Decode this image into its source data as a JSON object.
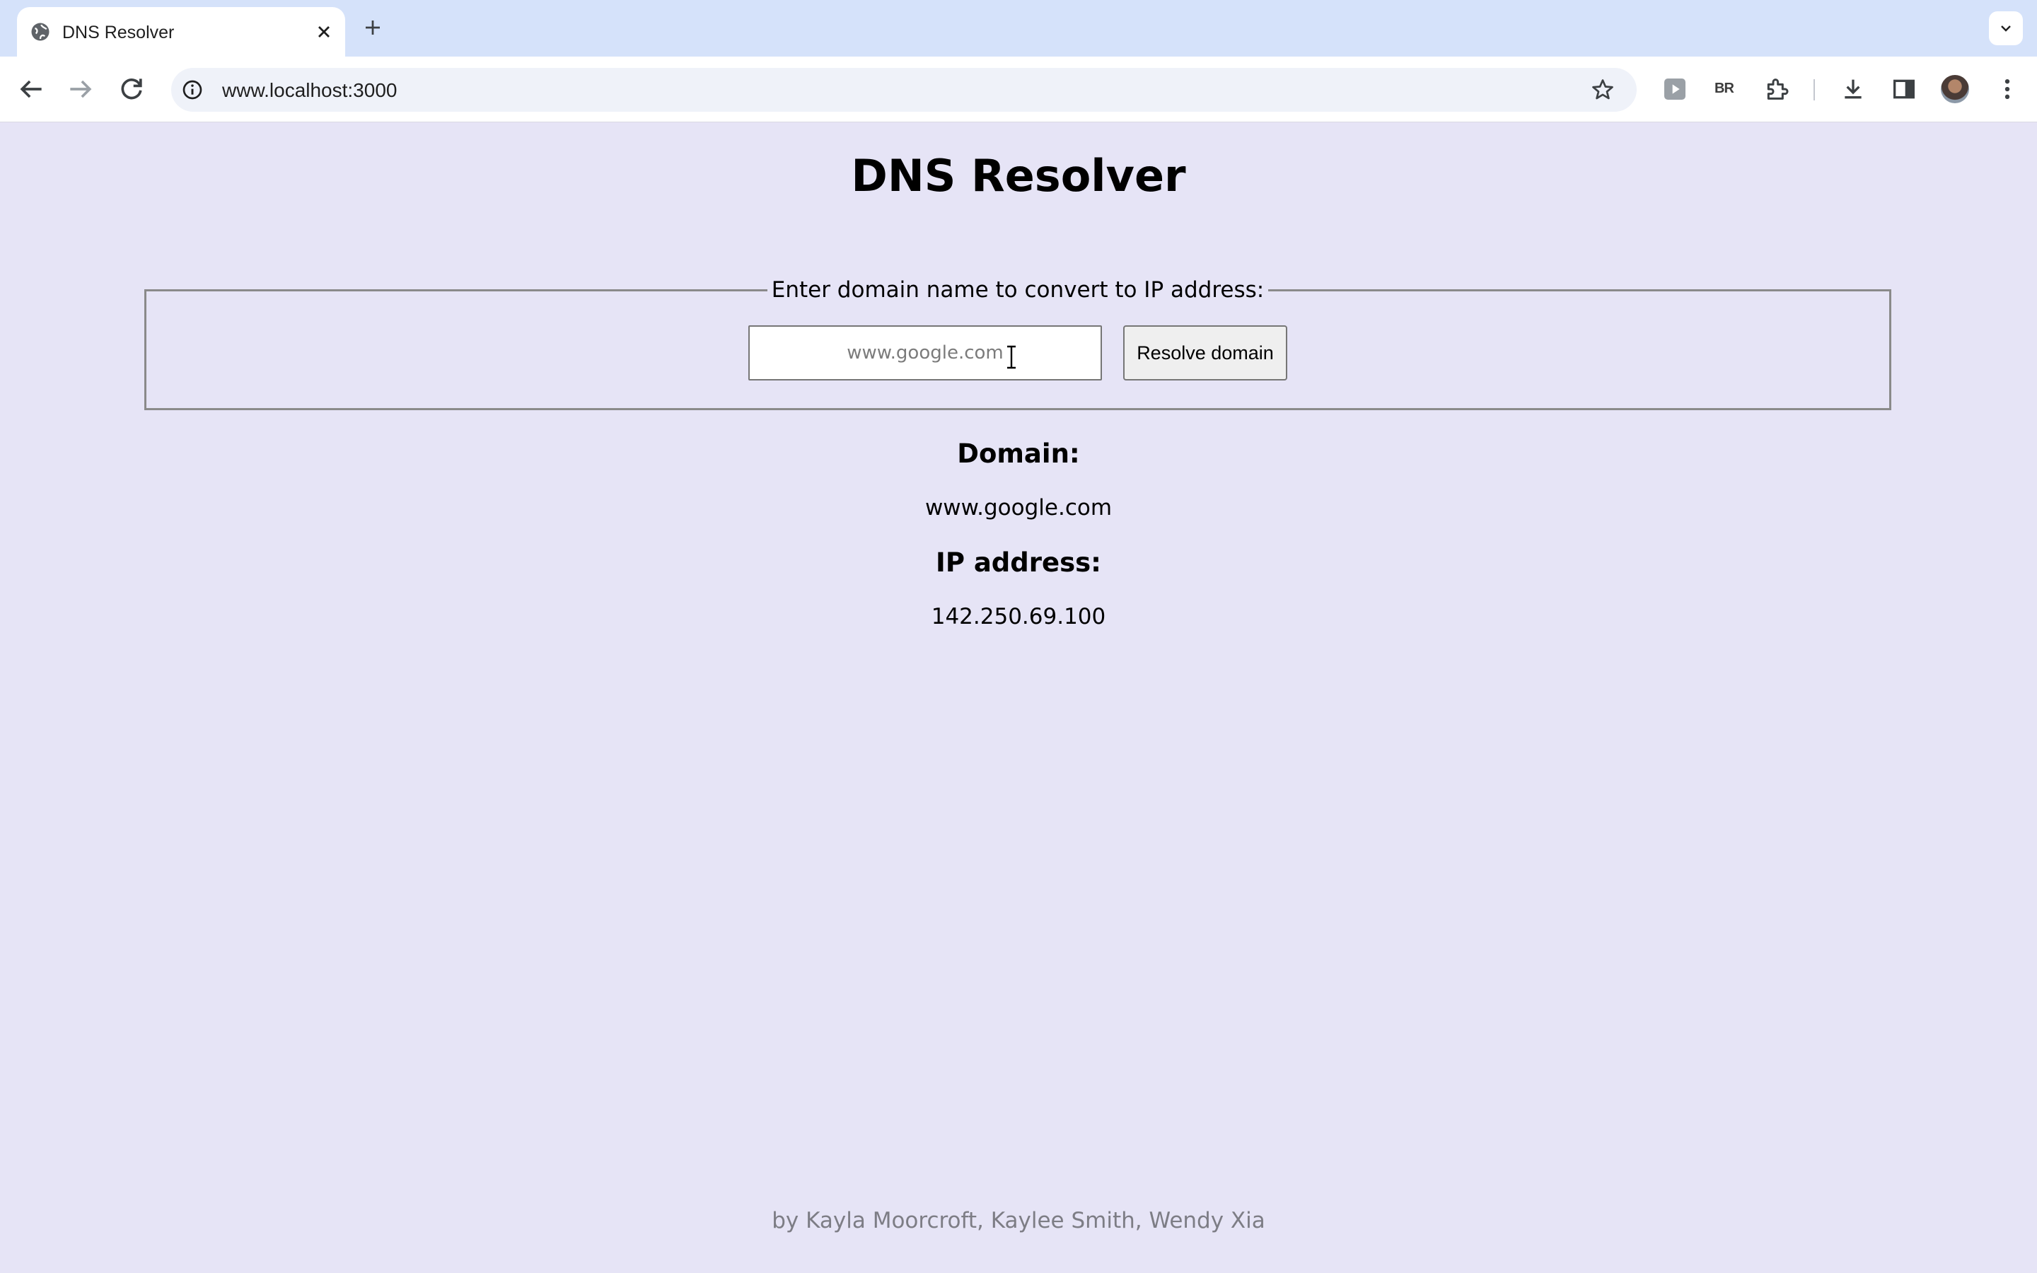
{
  "browser": {
    "tab_title": "DNS Resolver",
    "url": "www.localhost:3000",
    "extension_br_label": "BR",
    "icons": [
      "globe-icon",
      "close-icon",
      "plus-icon",
      "chevron-down-icon",
      "back-arrow-icon",
      "forward-arrow-icon",
      "reload-icon",
      "info-icon",
      "star-icon",
      "play-extension-icon",
      "puzzle-icon",
      "download-icon",
      "side-panel-icon",
      "avatar",
      "more-vert-icon"
    ]
  },
  "page": {
    "title": "DNS Resolver",
    "form": {
      "legend": "Enter domain name to convert to IP address:",
      "input_placeholder": "www.google.com",
      "button_label": "Resolve domain"
    },
    "result": {
      "domain_label": "Domain:",
      "domain_value": "www.google.com",
      "ip_label": "IP address:",
      "ip_value": "142.250.69.100"
    },
    "footer": "by Kayla Moorcroft, Kaylee Smith, Wendy Xia"
  },
  "colors": {
    "page_background": "#e6e4f6",
    "tabstrip_background": "#d5e2fa",
    "footer_text": "#7d7d85"
  }
}
